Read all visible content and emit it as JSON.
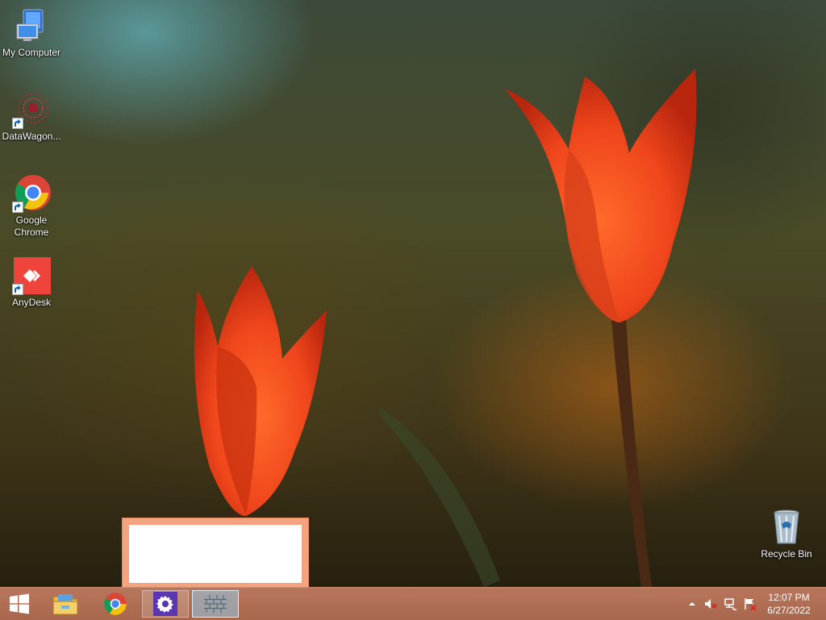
{
  "desktop": {
    "icons": [
      {
        "label": "My Computer",
        "icon": "computer-icon"
      },
      {
        "label": "DataWagon...",
        "icon": "datawagon-icon"
      },
      {
        "label": "Google Chrome",
        "icon": "chrome-icon"
      },
      {
        "label": "AnyDesk",
        "icon": "anydesk-icon"
      },
      {
        "label": "Recycle Bin",
        "icon": "recycle-bin-icon"
      }
    ]
  },
  "taskbar": {
    "start_icon": "windows-logo-icon",
    "pinned": [
      {
        "name": "file-explorer",
        "icon": "folder-icon"
      },
      {
        "name": "google-chrome",
        "icon": "chrome-icon"
      },
      {
        "name": "settings",
        "icon": "gear-icon"
      },
      {
        "name": "firewall",
        "icon": "brick-wall-icon"
      }
    ],
    "tray": {
      "icons": [
        "chevron-up-icon",
        "speaker-muted-icon",
        "network-icon",
        "action-center-flag-icon"
      ],
      "time": "12:07 PM",
      "date": "6/27/2022"
    }
  },
  "colors": {
    "taskbar": "#b07055",
    "thumbnail_border": "#f5a27f",
    "active_button": "#9cc9e3"
  }
}
